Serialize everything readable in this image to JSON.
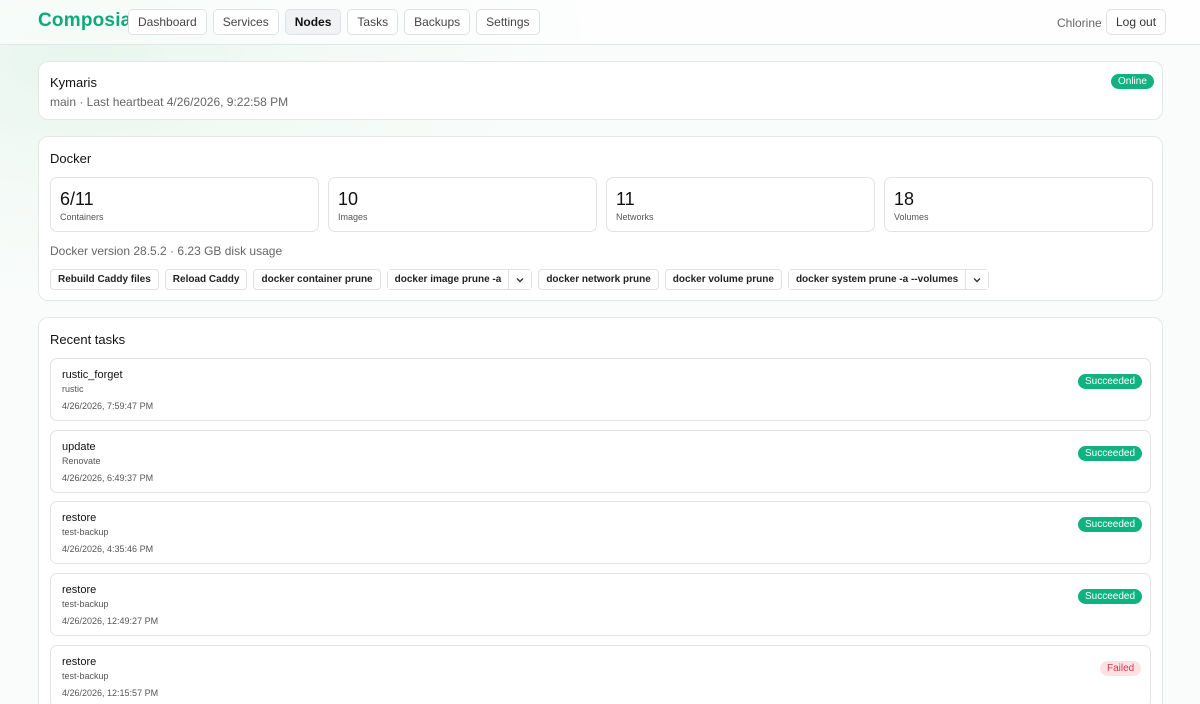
{
  "header": {
    "brand": "Composia",
    "nav": [
      {
        "label": "Dashboard"
      },
      {
        "label": "Services"
      },
      {
        "label": "Nodes"
      },
      {
        "label": "Tasks"
      },
      {
        "label": "Backups"
      },
      {
        "label": "Settings"
      }
    ],
    "active_tab": "Nodes",
    "user": "Chlorine",
    "logout_label": "Log out"
  },
  "node": {
    "name": "Kymaris",
    "meta": "main · Last heartbeat 4/26/2026, 9:22:58 PM",
    "status": "Online"
  },
  "docker": {
    "title": "Docker",
    "stats": [
      {
        "value": "6/11",
        "label": "Containers"
      },
      {
        "value": "10",
        "label": "Images"
      },
      {
        "value": "11",
        "label": "Networks"
      },
      {
        "value": "18",
        "label": "Volumes"
      }
    ],
    "meta": "Docker version 28.5.2 · 6.23 GB disk usage",
    "actions": {
      "rebuild_caddy": "Rebuild Caddy files",
      "reload_caddy": "Reload Caddy",
      "container_prune": "docker container prune",
      "image_prune": "docker image prune -a",
      "network_prune": "docker network prune",
      "volume_prune": "docker volume prune",
      "system_prune": "docker system prune -a --volumes"
    }
  },
  "tasks": {
    "title": "Recent tasks",
    "items": [
      {
        "name": "rustic_forget",
        "source": "rustic",
        "time": "4/26/2026, 7:59:47 PM",
        "status": "Succeeded"
      },
      {
        "name": "update",
        "source": "Renovate",
        "time": "4/26/2026, 6:49:37 PM",
        "status": "Succeeded"
      },
      {
        "name": "restore",
        "source": "test-backup",
        "time": "4/26/2026, 4:35:46 PM",
        "status": "Succeeded"
      },
      {
        "name": "restore",
        "source": "test-backup",
        "time": "4/26/2026, 12:49:27 PM",
        "status": "Succeeded"
      },
      {
        "name": "restore",
        "source": "test-backup",
        "time": "4/26/2026, 12:15:57 PM",
        "status": "Failed"
      }
    ]
  },
  "colors": {
    "brand": "#12a87a",
    "success": "#10b37f",
    "failed_bg": "#fde2e4",
    "failed_text": "#d2384a"
  }
}
